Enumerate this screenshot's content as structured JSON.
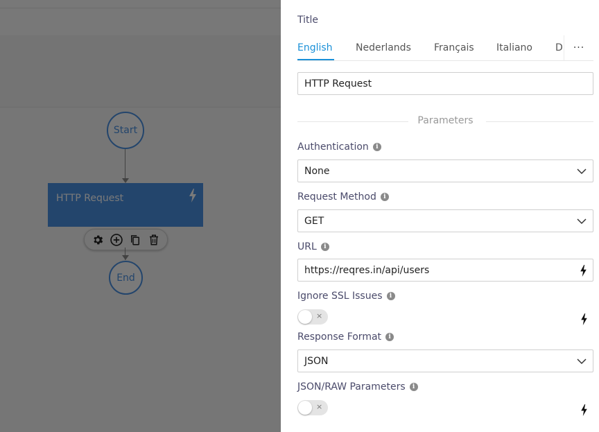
{
  "canvas": {
    "start_label": "Start",
    "end_label": "End",
    "http_node_label": "HTTP Request"
  },
  "panel": {
    "title_label": "Title",
    "tabs": [
      {
        "label": "English",
        "active": true
      },
      {
        "label": "Nederlands",
        "active": false
      },
      {
        "label": "Français",
        "active": false
      },
      {
        "label": "Italiano",
        "active": false
      },
      {
        "label": "D",
        "active": false
      }
    ],
    "more_label": "···",
    "title_value": "HTTP Request",
    "parameters_label": "Parameters",
    "authentication": {
      "label": "Authentication",
      "value": "None"
    },
    "request_method": {
      "label": "Request Method",
      "value": "GET"
    },
    "url": {
      "label": "URL",
      "value": "https://reqres.in/api/users"
    },
    "ignore_ssl": {
      "label": "Ignore SSL Issues",
      "enabled": false
    },
    "response_format": {
      "label": "Response Format",
      "value": "JSON"
    },
    "json_raw": {
      "label": "JSON/RAW Parameters",
      "enabled": false
    },
    "info_glyph": "i",
    "toggle_off_glyph": "×"
  },
  "colors": {
    "accent": "#1a90d8",
    "node_blue": "#4a90e2",
    "overlay": "rgba(0,0,0,0.52)"
  }
}
